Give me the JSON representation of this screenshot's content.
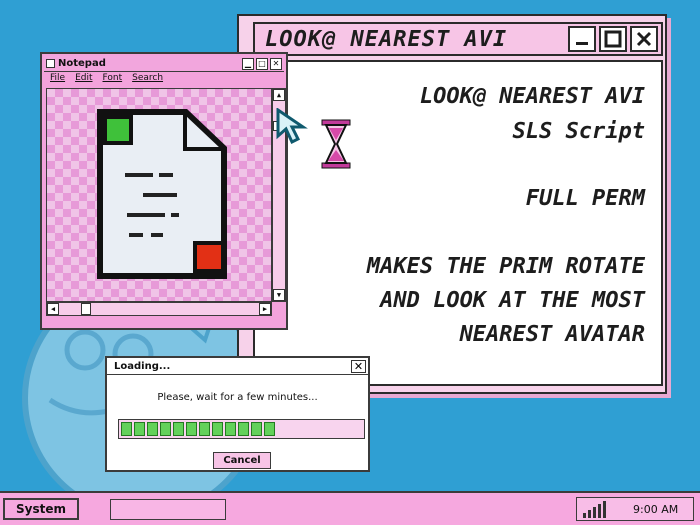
{
  "script_window": {
    "title": "LOOK@ NEAREST AVI",
    "lines": [
      "LOOK@ NEAREST AVI",
      "SLS Script",
      "FULL PERM",
      "MAKES THE PRIM ROTATE",
      "AND LOOK AT THE MOST",
      "NEAREST AVATAR"
    ],
    "controls": {
      "minimize_icon": "minimize-icon",
      "maximize_icon": "maximize-icon",
      "close_icon": "close-icon"
    }
  },
  "notepad": {
    "title": "Notepad",
    "menu": [
      "File",
      "Edit",
      "Font",
      "Search"
    ],
    "icon": "document-icon"
  },
  "loading_dialog": {
    "title": "Loading...",
    "message": "Please, wait for a few minutes...",
    "progress_segments_filled": 12,
    "progress_segments_total": 20,
    "cancel_label": "Cancel"
  },
  "taskbar": {
    "start_label": "System",
    "clock": "9:00 AM"
  },
  "colors": {
    "desktop": "#2f9fd3",
    "window_pink": "#f6a8df",
    "progress_green": "#63d15a"
  }
}
